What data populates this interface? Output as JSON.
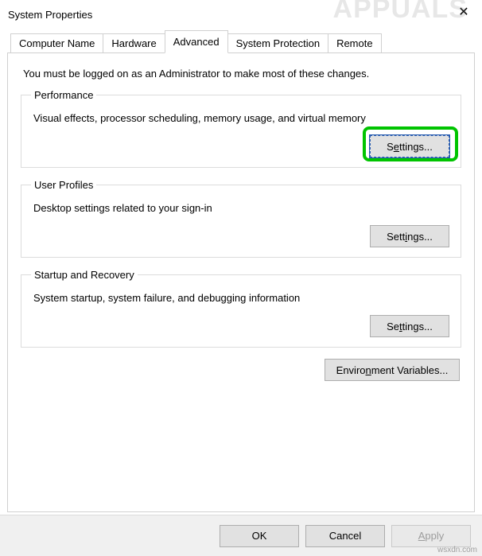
{
  "window": {
    "title": "System Properties",
    "close_label": "✕"
  },
  "tabs": {
    "items": [
      {
        "label": "Computer Name"
      },
      {
        "label": "Hardware"
      },
      {
        "label": "Advanced"
      },
      {
        "label": "System Protection"
      },
      {
        "label": "Remote"
      }
    ],
    "active_index": 2
  },
  "advanced_page": {
    "intro": "You must be logged on as an Administrator to make most of these changes.",
    "performance": {
      "legend": "Performance",
      "desc": "Visual effects, processor scheduling, memory usage, and virtual memory",
      "button_pre": "S",
      "button_u": "e",
      "button_post": "ttings..."
    },
    "user_profiles": {
      "legend": "User Profiles",
      "desc": "Desktop settings related to your sign-in",
      "button_pre": "Sett",
      "button_u": "i",
      "button_post": "ngs..."
    },
    "startup": {
      "legend": "Startup and Recovery",
      "desc": "System startup, system failure, and debugging information",
      "button_pre": "Se",
      "button_u": "t",
      "button_post": "tings..."
    },
    "env_button_pre": "Enviro",
    "env_button_u": "n",
    "env_button_post": "ment Variables..."
  },
  "footer": {
    "ok": "OK",
    "cancel": "Cancel",
    "apply_u": "A",
    "apply_post": "pply"
  },
  "watermark": "APPUALS",
  "url_mark": "wsxdn.com"
}
